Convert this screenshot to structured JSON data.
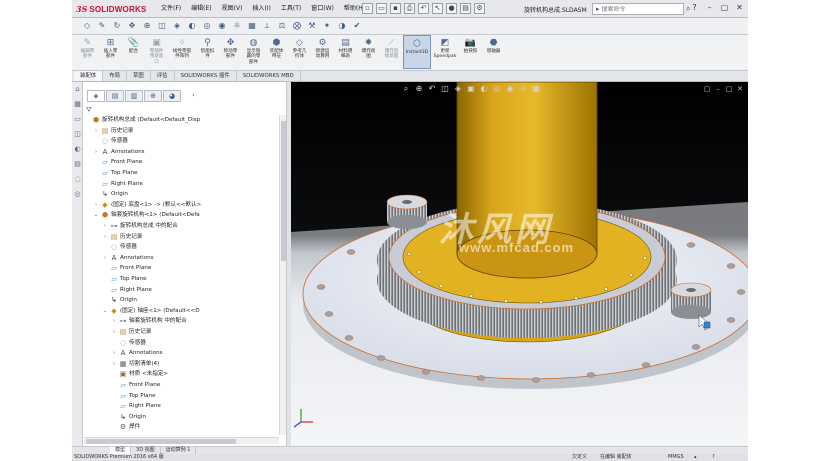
{
  "app": {
    "logo_ds": "3S",
    "logo_text": "SOLIDWORKS",
    "document_title": "旋转机构总成.SLDASM"
  },
  "menu": [
    "文件(F)",
    "编辑(E)",
    "视图(V)",
    "插入(I)",
    "工具(T)",
    "窗口(W)",
    "帮助(H)"
  ],
  "search": {
    "placeholder": "搜索命令"
  },
  "command_manager": {
    "buttons": [
      {
        "label": "编辑零\n部件",
        "icon": "edit-component-icon",
        "disabled": true
      },
      {
        "label": "插入零\n部件",
        "icon": "insert-component-icon",
        "disabled": false
      },
      {
        "label": "配合",
        "icon": "mate-icon",
        "disabled": false
      },
      {
        "label": "零部件\n预览窗\n口",
        "icon": "component-preview-icon",
        "disabled": true
      },
      {
        "label": "线性零部\n件阵列",
        "icon": "linear-pattern-icon",
        "disabled": false
      },
      {
        "label": "智能扣\n件",
        "icon": "smart-fastener-icon",
        "disabled": false
      },
      {
        "label": "移动零\n部件",
        "icon": "move-component-icon",
        "disabled": false
      },
      {
        "label": "显示隐\n藏的零\n部件",
        "icon": "show-hidden-icon",
        "disabled": false
      },
      {
        "label": "装配体\n特征",
        "icon": "assembly-feature-icon",
        "disabled": false
      },
      {
        "label": "参考几\n何体",
        "icon": "reference-geometry-icon",
        "disabled": false
      },
      {
        "label": "新建运\n动算例",
        "icon": "new-motion-study-icon",
        "disabled": false
      },
      {
        "label": "材料明\n细表",
        "icon": "bom-icon",
        "disabled": false
      },
      {
        "label": "爆炸视\n图",
        "icon": "exploded-view-icon",
        "disabled": false
      },
      {
        "label": "爆炸直\n线草图",
        "icon": "explode-line-sketch-icon",
        "disabled": true
      },
      {
        "label": "Instant3D",
        "icon": "instant3d-icon",
        "disabled": false,
        "active": true
      },
      {
        "label": "更新\nSpeedpak",
        "icon": "speedpak-icon",
        "disabled": false
      },
      {
        "label": "拍快照",
        "icon": "snapshot-icon",
        "disabled": false
      },
      {
        "label": "增轴器",
        "icon": "large-assembly-icon",
        "disabled": false
      }
    ]
  },
  "command_tabs": [
    "装配体",
    "布局",
    "草图",
    "评估",
    "SOLIDWORKS 插件",
    "SOLIDWORKS MBD"
  ],
  "feature_tree": [
    {
      "depth": 0,
      "exp": "",
      "icon": "assembly-icon",
      "label": "旋转机构总成  (Default<Default_Disp"
    },
    {
      "depth": 1,
      "exp": "›",
      "icon": "history-icon",
      "label": "历史记录"
    },
    {
      "depth": 1,
      "exp": "",
      "icon": "sensor-icon",
      "label": "传感器"
    },
    {
      "depth": 1,
      "exp": "›",
      "icon": "annotations-icon",
      "label": "Annotations"
    },
    {
      "depth": 1,
      "exp": "",
      "icon": "plane-icon",
      "label": "Front Plane"
    },
    {
      "depth": 1,
      "exp": "",
      "icon": "plane-icon",
      "label": "Top Plane"
    },
    {
      "depth": 1,
      "exp": "",
      "icon": "plane-icon",
      "label": "Right Plane"
    },
    {
      "depth": 1,
      "exp": "",
      "icon": "origin-icon",
      "label": "Origin"
    },
    {
      "depth": 1,
      "exp": "›",
      "icon": "part-icon",
      "label": "(固定) 底盘<1> -> (默认<<默认>"
    },
    {
      "depth": 1,
      "exp": "⌄",
      "icon": "subassembly-icon",
      "label": "轴套旋转机构<1> (Default<Defa"
    },
    {
      "depth": 2,
      "exp": "›",
      "icon": "mates-icon",
      "label": "旋转机构总成 中的配合"
    },
    {
      "depth": 2,
      "exp": "›",
      "icon": "history-icon",
      "label": "历史记录"
    },
    {
      "depth": 2,
      "exp": "",
      "icon": "sensor-icon",
      "label": "传感器"
    },
    {
      "depth": 2,
      "exp": "›",
      "icon": "annotations-icon",
      "label": "Annotations"
    },
    {
      "depth": 2,
      "exp": "",
      "icon": "plane-icon",
      "label": "Front Plane"
    },
    {
      "depth": 2,
      "exp": "",
      "icon": "plane-icon",
      "label": "Top Plane"
    },
    {
      "depth": 2,
      "exp": "",
      "icon": "plane-icon",
      "label": "Right Plane"
    },
    {
      "depth": 2,
      "exp": "",
      "icon": "origin-icon",
      "label": "Origin"
    },
    {
      "depth": 2,
      "exp": "⌄",
      "icon": "part-icon",
      "label": "(固定) 轴座<1> (Default<<D"
    },
    {
      "depth": 3,
      "exp": "›",
      "icon": "mates-icon",
      "label": "轴套旋转机构 中的配合"
    },
    {
      "depth": 3,
      "exp": "›",
      "icon": "history-icon",
      "label": "历史记录"
    },
    {
      "depth": 3,
      "exp": "",
      "icon": "sensor-icon",
      "label": "传感器"
    },
    {
      "depth": 3,
      "exp": "›",
      "icon": "annotations-icon",
      "label": "Annotations"
    },
    {
      "depth": 3,
      "exp": "›",
      "icon": "cut-list-icon",
      "label": "切割清单(4)"
    },
    {
      "depth": 3,
      "exp": "",
      "icon": "material-icon",
      "label": "材质 <未指定>"
    },
    {
      "depth": 3,
      "exp": "",
      "icon": "plane-icon",
      "label": "Front Plane"
    },
    {
      "depth": 3,
      "exp": "",
      "icon": "plane-icon",
      "label": "Top Plane"
    },
    {
      "depth": 3,
      "exp": "",
      "icon": "plane-icon",
      "label": "Right Plane"
    },
    {
      "depth": 3,
      "exp": "",
      "icon": "origin-icon",
      "label": "Origin"
    },
    {
      "depth": 3,
      "exp": "",
      "icon": "feature-icon",
      "label": "焊件"
    }
  ],
  "watermark": {
    "cn": "沐风网",
    "en": "www.mfcad.com"
  },
  "model_tabs": [
    "模型",
    "3D 视图",
    "运动算例 1"
  ],
  "status": {
    "product": "SOLIDWORKS Premium 2016 x64 版",
    "definition": "欠定义",
    "editing": "在编辑 装配体",
    "units": "MMGS"
  }
}
